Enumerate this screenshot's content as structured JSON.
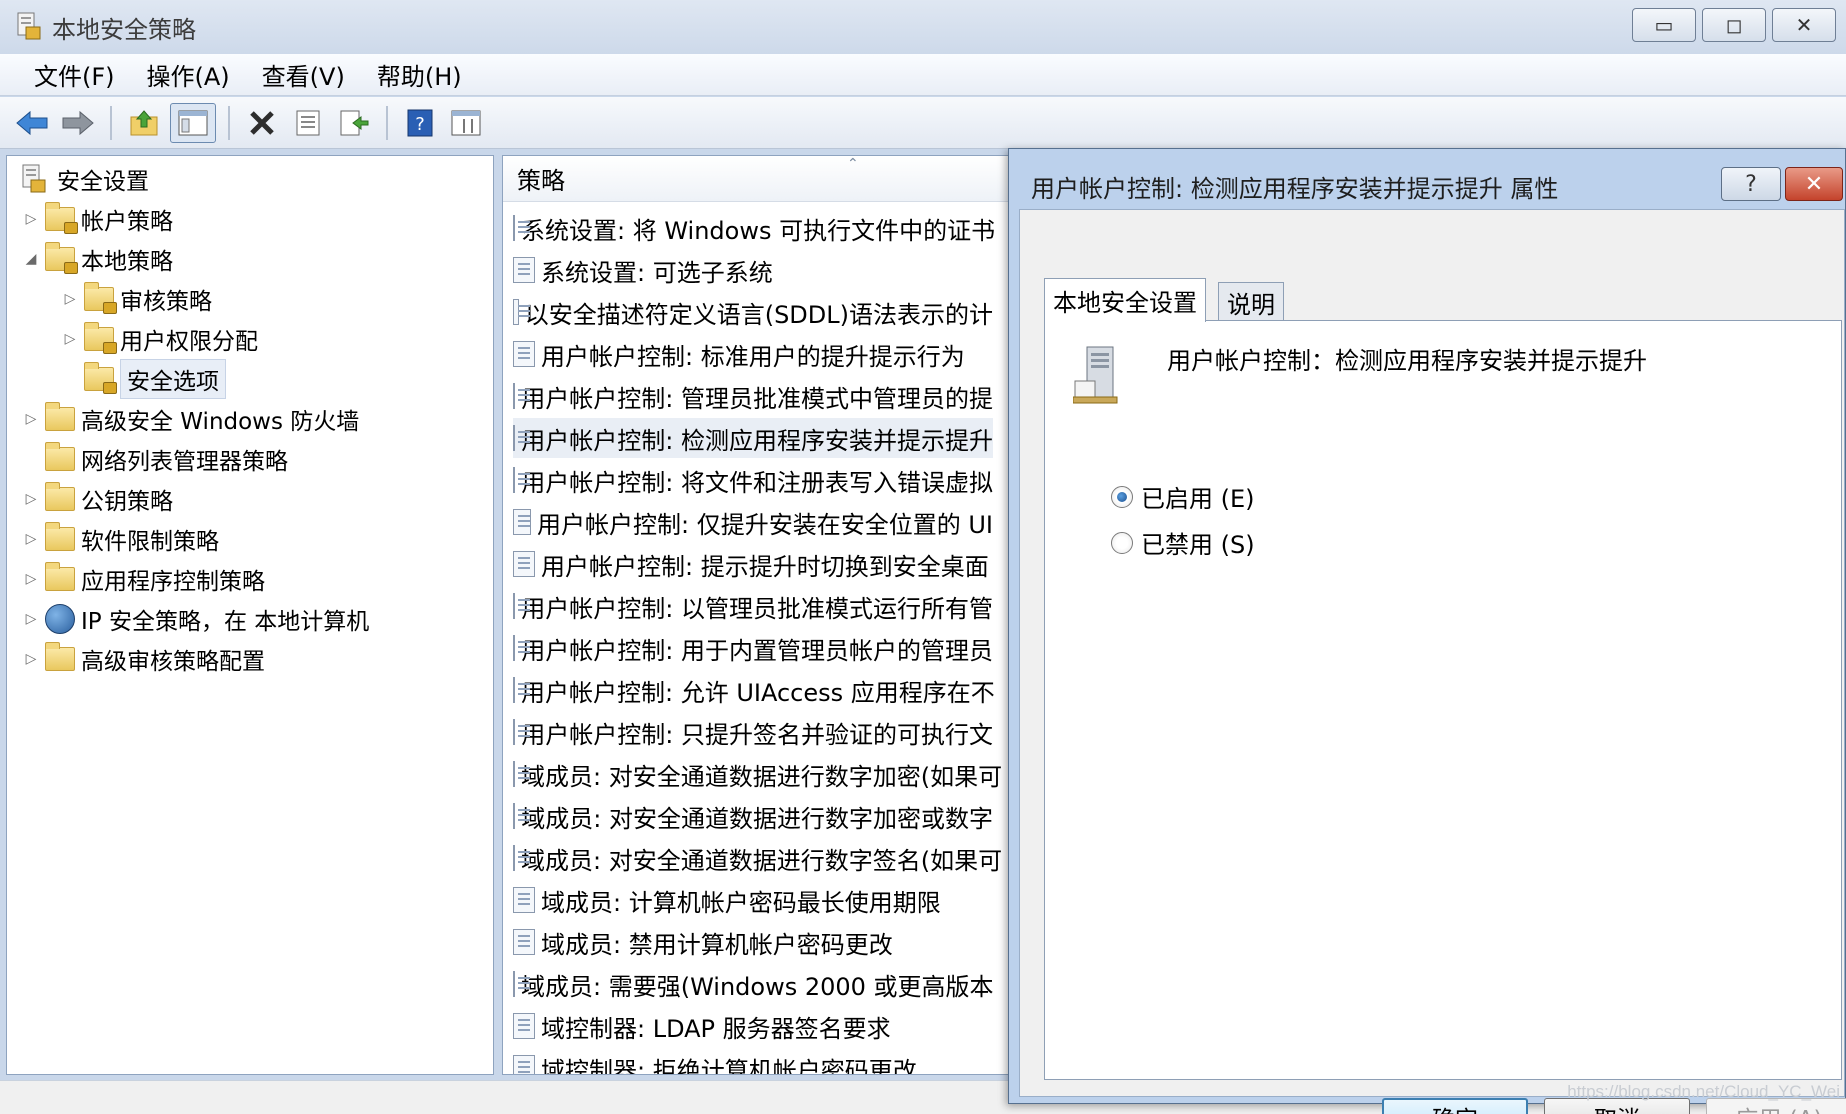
{
  "window": {
    "title": "本地安全策略",
    "controls": {
      "minimize": "▭",
      "maximize": "◻",
      "close": "✕"
    }
  },
  "menu": [
    "文件(F)",
    "操作(A)",
    "查看(V)",
    "帮助(H)"
  ],
  "toolbar": [
    "back-arrow-icon",
    "forward-arrow-icon",
    "up-folder-icon",
    "show-hide-tree-icon",
    "delete-icon",
    "properties-icon",
    "export-list-icon",
    "help-icon",
    "columns-icon"
  ],
  "tree": {
    "root": "安全设置",
    "items": [
      {
        "label": "帐户策略",
        "expander": "▷"
      },
      {
        "label": "本地策略",
        "expander": "◢"
      },
      {
        "label": "审核策略",
        "expander": "▷"
      },
      {
        "label": "用户权限分配",
        "expander": "▷"
      },
      {
        "label": "安全选项",
        "expander": ""
      },
      {
        "label": "高级安全 Windows 防火墙",
        "expander": "▷"
      },
      {
        "label": "网络列表管理器策略",
        "expander": ""
      },
      {
        "label": "公钥策略",
        "expander": "▷"
      },
      {
        "label": "软件限制策略",
        "expander": "▷"
      },
      {
        "label": "应用程序控制策略",
        "expander": "▷"
      },
      {
        "label": "IP 安全策略，在 本地计算机",
        "expander": "▷"
      },
      {
        "label": "高级审核策略配置",
        "expander": "▷"
      }
    ]
  },
  "list": {
    "column": "策略",
    "sort_caret": "⌃",
    "rows": [
      "系统设置: 将 Windows 可执行文件中的证书",
      "系统设置: 可选子系统",
      "以安全描述符定义语言(SDDL)语法表示的计",
      "用户帐户控制: 标准用户的提升提示行为",
      "用户帐户控制: 管理员批准模式中管理员的提",
      "用户帐户控制: 检测应用程序安装并提示提升",
      "用户帐户控制: 将文件和注册表写入错误虚拟",
      "用户帐户控制: 仅提升安装在安全位置的 UI",
      "用户帐户控制: 提示提升时切换到安全桌面",
      "用户帐户控制: 以管理员批准模式运行所有管",
      "用户帐户控制: 用于内置管理员帐户的管理员",
      "用户帐户控制: 允许 UIAccess 应用程序在不",
      "用户帐户控制: 只提升签名并验证的可执行文",
      "域成员: 对安全通道数据进行数字加密(如果可",
      "域成员: 对安全通道数据进行数字加密或数字",
      "域成员: 对安全通道数据进行数字签名(如果可",
      "域成员: 计算机帐户密码最长使用期限",
      "域成员: 禁用计算机帐户密码更改",
      "域成员: 需要强(Windows 2000 或更高版本",
      "域控制器: LDAP 服务器签名要求",
      "域控制器: 拒绝计算机帐户密码更改"
    ]
  },
  "dialog": {
    "title": "用户帐户控制: 检测应用程序安装并提示提升 属性",
    "help_glyph": "?",
    "close_glyph": "✕",
    "tabs": [
      "本地安全设置",
      "说明"
    ],
    "setting_name": "用户帐户控制：检测应用程序安装并提示提升",
    "options": [
      {
        "label": "已启用 (E)",
        "checked": true
      },
      {
        "label": "已禁用 (S)",
        "checked": false
      }
    ],
    "buttons": {
      "ok": "确定",
      "cancel": "取消",
      "apply": "应用 (A)"
    }
  },
  "watermark": "https://blog.csdn.net/Cloud_YC_Wei"
}
